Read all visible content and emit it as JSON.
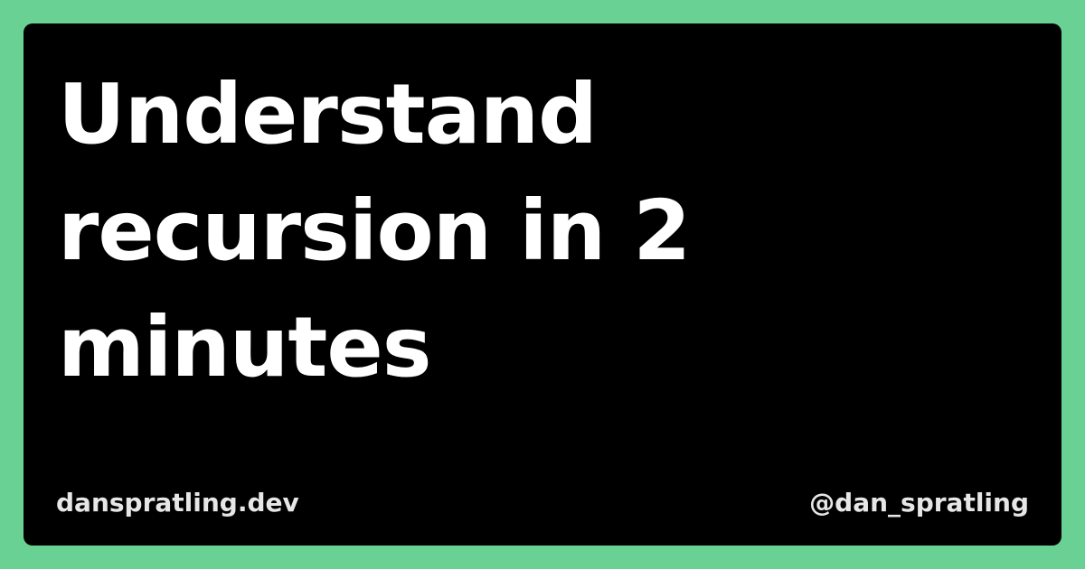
{
  "colors": {
    "background": "#6ad194",
    "card": "#000000",
    "title_text": "#ffffff",
    "footer_text": "#e6e6e6"
  },
  "card": {
    "title": "Understand recursion in 2 minutes",
    "site": "danspratling.dev",
    "handle": "@dan_spratling"
  }
}
